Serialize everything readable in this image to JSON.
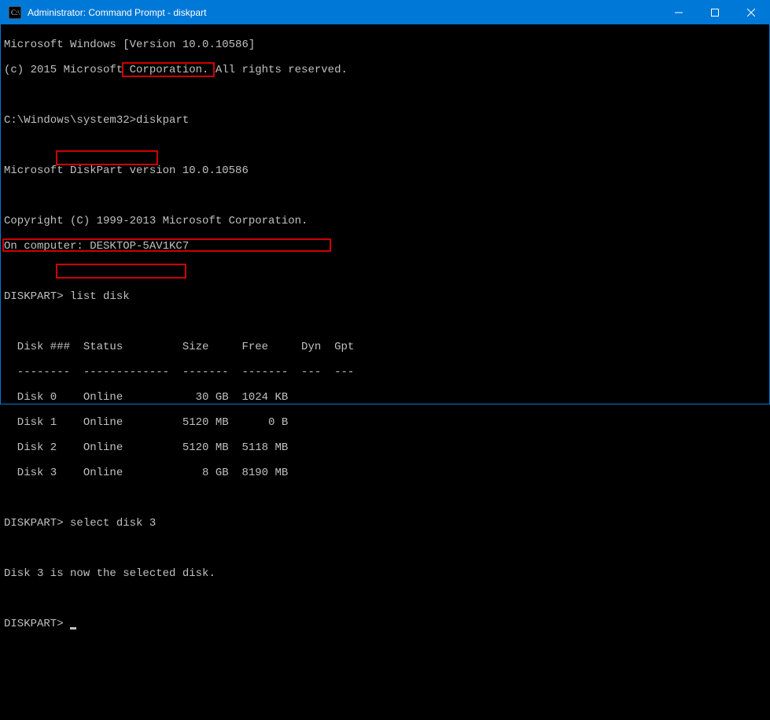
{
  "titlebar": {
    "title": "Administrator: Command Prompt - diskpart"
  },
  "terminal": {
    "version_line": "Microsoft Windows [Version 10.0.10586]",
    "copyright_win": "(c) 2015 Microsoft Corporation. All rights reserved.",
    "prompt1_prefix": "C:\\Windows\\system32>",
    "cmd_diskpart": "diskpart",
    "dp_version": "Microsoft DiskPart version 10.0.10586",
    "dp_copyright": "Copyright (C) 1999-2013 Microsoft Corporation.",
    "dp_computer": "On computer: DESKTOP-5AV1KC7",
    "dp_prompt": "DISKPART>",
    "cmd_listdisk": "list disk",
    "table_header": "  Disk ###  Status         Size     Free     Dyn  Gpt",
    "table_divider": "  --------  -------------  -------  -------  ---  ---",
    "rows": [
      "  Disk 0    Online           30 GB  1024 KB",
      "  Disk 1    Online         5120 MB      0 B",
      "  Disk 2    Online         5120 MB  5118 MB",
      "  Disk 3    Online            8 GB  8190 MB"
    ],
    "cmd_selectdisk": "select disk 3",
    "select_result": "Disk 3 is now the selected disk."
  },
  "chart_data": {
    "type": "table",
    "title": "list disk",
    "columns": [
      "Disk ###",
      "Status",
      "Size",
      "Free",
      "Dyn",
      "Gpt"
    ],
    "rows": [
      {
        "disk": "Disk 0",
        "status": "Online",
        "size": "30 GB",
        "free": "1024 KB",
        "dyn": "",
        "gpt": ""
      },
      {
        "disk": "Disk 1",
        "status": "Online",
        "size": "5120 MB",
        "free": "0 B",
        "dyn": "",
        "gpt": ""
      },
      {
        "disk": "Disk 2",
        "status": "Online",
        "size": "5120 MB",
        "free": "5118 MB",
        "dyn": "",
        "gpt": ""
      },
      {
        "disk": "Disk 3",
        "status": "Online",
        "size": "8 GB",
        "free": "8190 MB",
        "dyn": "",
        "gpt": ""
      }
    ]
  }
}
